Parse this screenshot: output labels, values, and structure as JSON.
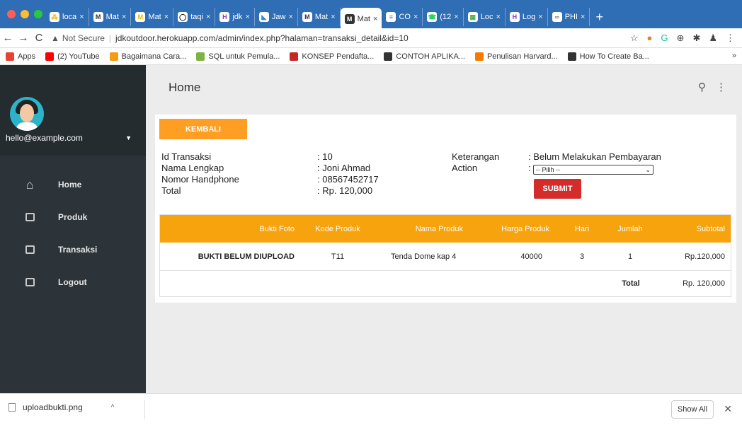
{
  "browser": {
    "tabs": [
      {
        "label": "loca",
        "icon": "⁂",
        "color": "#f5b400"
      },
      {
        "label": "Mat",
        "icon": "M",
        "color": "#333"
      },
      {
        "label": "Mat",
        "icon": "M",
        "color": "#f5b400"
      },
      {
        "label": "taqi",
        "icon": "◯",
        "color": "#111"
      },
      {
        "label": "jdk",
        "icon": "H",
        "color": "#7b3fbf"
      },
      {
        "label": "Jaw",
        "icon": "◣",
        "color": "#2c8bd6"
      },
      {
        "label": "Mat",
        "icon": "M",
        "color": "#333"
      },
      {
        "label": "Mat",
        "icon": "M",
        "color": "#333",
        "active": true
      },
      {
        "label": "CO",
        "icon": "≡",
        "color": "#fff"
      },
      {
        "label": "(12",
        "icon": "☎",
        "color": "#25d366"
      },
      {
        "label": "Loc",
        "icon": "▦",
        "color": "#4caf50"
      },
      {
        "label": "Log",
        "icon": "H",
        "color": "#7b3fbf"
      },
      {
        "label": "PHI",
        "icon": "∞",
        "color": "#777"
      }
    ],
    "security_label": "Not Secure",
    "url": "jdkoutdoor.herokuapp.com/admin/index.php?halaman=transaksi_detail&id=10",
    "bookmarks": [
      {
        "label": "Apps",
        "color": "#e94235"
      },
      {
        "label": "(2) YouTube",
        "color": "#ff0000"
      },
      {
        "label": "Bagaimana Cara...",
        "color": "#f39c12"
      },
      {
        "label": "SQL untuk Pemula...",
        "color": "#7cb342"
      },
      {
        "label": "KONSEP Pendafta...",
        "color": "#c62828"
      },
      {
        "label": "CONTOH APLIKA...",
        "color": "#333"
      },
      {
        "label": "Penulisan Harvard...",
        "color": "#f57c00"
      },
      {
        "label": "How To Create Ba...",
        "color": "#333"
      }
    ],
    "bookmarks_more": "»"
  },
  "sidebar": {
    "user_email": "hello@example.com",
    "items": [
      {
        "label": "Home",
        "icon": "home-icon"
      },
      {
        "label": "Produk",
        "icon": "inbox-icon"
      },
      {
        "label": "Transaksi",
        "icon": "inbox-icon"
      },
      {
        "label": "Logout",
        "icon": "inbox-icon"
      }
    ]
  },
  "header": {
    "title": "Home"
  },
  "detail": {
    "back_label": "KEMBALI",
    "labels_left": [
      "Id Transaksi",
      "Nama Lengkap",
      "Nomor Handphone",
      "Total"
    ],
    "values_left": [
      ": 10",
      ": Joni Ahmad",
      ": 08567452717",
      ": Rp. 120,000"
    ],
    "labels_right": [
      "Keterangan",
      "Action"
    ],
    "values_right": [
      ": Belum Melakukan Pembayaran",
      ":"
    ],
    "action_select": "-- Pilih --",
    "submit_label": "SUBMIT"
  },
  "table": {
    "headers": [
      "Bukti Foto",
      "Kode Produk",
      "Nama Produk",
      "Harga Produk",
      "Hari",
      "Jumlah",
      "Subtotal"
    ],
    "rows": [
      [
        "BUKTI BELUM DIUPLOAD",
        "T11",
        "Tenda Dome kap 4",
        "40000",
        "3",
        "1",
        "Rp.120,000"
      ]
    ],
    "total_label": "Total",
    "total_value": "Rp. 120,000"
  },
  "downloads": {
    "file_name": "uploadbukti.png",
    "show_all_label": "Show All"
  },
  "colors": {
    "accent_orange": "#f7a30e",
    "submit_red": "#d42b2b",
    "sidebar_dark": "#2c3439"
  }
}
